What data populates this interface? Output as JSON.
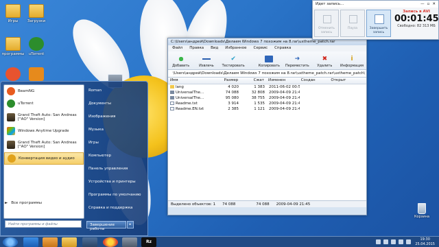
{
  "desktop": {
    "icons": [
      {
        "label": "Игры"
      },
      {
        "label": "Загрузки"
      },
      {
        "label": "программы"
      },
      {
        "label": "uTorrent"
      }
    ],
    "recycle_bin": "Корзина"
  },
  "start_menu": {
    "programs": [
      {
        "label": "BeamNG"
      },
      {
        "label": "uTorrent"
      },
      {
        "label": "Grand Theft Auto: San Andreas [\"AO\" Version]"
      },
      {
        "label": "Windows Anytime Upgrade"
      },
      {
        "label": "Grand Theft Auto: San Andreas [\"AO\" Version]"
      },
      {
        "label": "Конвертация видео и аудио"
      }
    ],
    "all_programs": "Все программы",
    "search_placeholder": "Найти программы и файлы",
    "right_links": [
      {
        "label": "Roman"
      },
      {
        "label": "Документы"
      },
      {
        "label": "Изображения"
      },
      {
        "label": "Музыка"
      },
      {
        "label": "Игры"
      },
      {
        "label": "Компьютер"
      },
      {
        "label": "Панель управления"
      },
      {
        "label": "Устройства и принтеры"
      },
      {
        "label": "Программы по умолчанию"
      },
      {
        "label": "Справка и поддержка"
      }
    ],
    "shutdown": "Завершение работы"
  },
  "winrar": {
    "title": "C:\\Users\\андрей\\Downloads\\Делаем Windows 7 похожим на 8.rar\\uxtheme_patch.rar",
    "menu": [
      "Файл",
      "Правка",
      "Вид",
      "Избранное",
      "Сервис",
      "Справка"
    ],
    "toolbar": [
      "Добавить",
      "Извлечь",
      "Тестировать",
      "Копировать",
      "Переместить",
      "Удалить",
      "Информация"
    ],
    "address": "\\Users\\андрей\\Downloads\\Делаем Windows 7 похожим на 8.rar\\uxtheme_patch.rar\\uxtheme_patch\\",
    "columns": [
      "Имя",
      "Размер",
      "Сжат",
      "Изменен",
      "Создан",
      "Открыт"
    ],
    "files": [
      {
        "name": "lang",
        "size": "4 020",
        "packed": "1 383",
        "modified": "2011-06-02 00:50"
      },
      {
        "name": "UniversalThe...",
        "size": "74 088",
        "packed": "32 808",
        "modified": "2009-04-09 21:45"
      },
      {
        "name": "UniversalThe...",
        "size": "95 080",
        "packed": "38 755",
        "modified": "2009-04-09 21:45"
      },
      {
        "name": "Readme.txt",
        "size": "3 914",
        "packed": "1 535",
        "modified": "2009-04-09 21:45"
      },
      {
        "name": "Readme.EN.txt",
        "size": "2 385",
        "packed": "1 121",
        "modified": "2009-04-09 21:45"
      }
    ],
    "status": {
      "selected": "Выделено объектов: 1",
      "size": "74 088",
      "packed": "74 088",
      "date": "2009-04-09 21:45"
    }
  },
  "recorder": {
    "title": "Идет запись...",
    "buttons": [
      "Отменить запись",
      "Пауза",
      "Завершить запись"
    ],
    "record_label": "Запись в AVI",
    "time": "00:01:45",
    "free_space": "Свободно: 82 313 МБ"
  },
  "taskbar": {
    "time": "19:30",
    "date": "25.04.2015"
  }
}
